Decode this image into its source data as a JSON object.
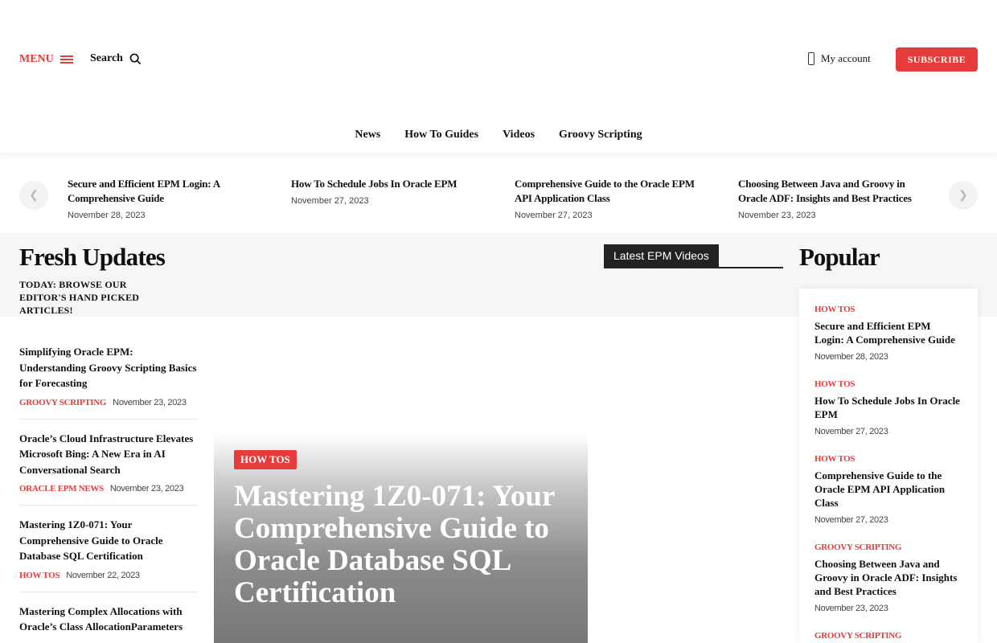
{
  "header": {
    "menu_label": "MENU",
    "search_label": "Search",
    "account_label": "My account",
    "subscribe_label": "SUBSCRIBE"
  },
  "nav": [
    "News",
    "How To Guides",
    "Videos",
    "Groovy Scripting"
  ],
  "ticker": [
    {
      "title": "Secure and Efficient EPM Login: A Comprehensive Guide",
      "date": "November 28, 2023"
    },
    {
      "title": "How To Schedule Jobs In Oracle EPM",
      "date": "November 27, 2023"
    },
    {
      "title": "Comprehensive Guide to the Oracle EPM API Application Class",
      "date": "November 27, 2023"
    },
    {
      "title": "Choosing Between Java and Groovy in Oracle ADF: Insights and Best Practices",
      "date": "November 23, 2023"
    }
  ],
  "fresh": {
    "title": "Fresh Updates",
    "subtitle": "TODAY: BROWSE OUR EDITOR'S HAND PICKED ARTICLES!"
  },
  "videos_tab": "Latest EPM Videos",
  "popular_title": "Popular",
  "left_list": [
    {
      "title": "Simplifying Oracle EPM: Understanding Groovy Scripting Basics for Forecasting",
      "category": "GROOVY SCRIPTING",
      "date": "November 23, 2023"
    },
    {
      "title": "Oracle’s Cloud Infrastructure Elevates Microsoft Bing: A New Era in AI Conversational Search",
      "category": "ORACLE EPM NEWS",
      "date": "November 23, 2023"
    },
    {
      "title": "Mastering 1Z0-071: Your Comprehensive Guide to Oracle Database SQL Certification",
      "category": "HOW TOS",
      "date": "November 22, 2023"
    },
    {
      "title": "Mastering Complex Allocations with Oracle’s Class AllocationParameters",
      "category": "",
      "date": ""
    }
  ],
  "feature": {
    "category": "HOW TOS",
    "title": "Mastering 1Z0-071: Your Comprehensive Guide to Oracle Database SQL Certification"
  },
  "popular": [
    {
      "category": "HOW TOS",
      "title": "Secure and Efficient EPM Login: A Comprehensive Guide",
      "date": "November 28, 2023"
    },
    {
      "category": "HOW TOS",
      "title": "How To Schedule Jobs In Oracle EPM",
      "date": "November 27, 2023"
    },
    {
      "category": "HOW TOS",
      "title": "Comprehensive Guide to the Oracle EPM API Application Class",
      "date": "November 27, 2023"
    },
    {
      "category": "GROOVY SCRIPTING",
      "title": "Choosing Between Java and Groovy in Oracle ADF: Insights and Best Practices",
      "date": "November 23, 2023"
    },
    {
      "category": "GROOVY SCRIPTING",
      "title": "",
      "date": ""
    }
  ],
  "colors": {
    "accent": "#e53b3b",
    "dark": "#222222"
  }
}
